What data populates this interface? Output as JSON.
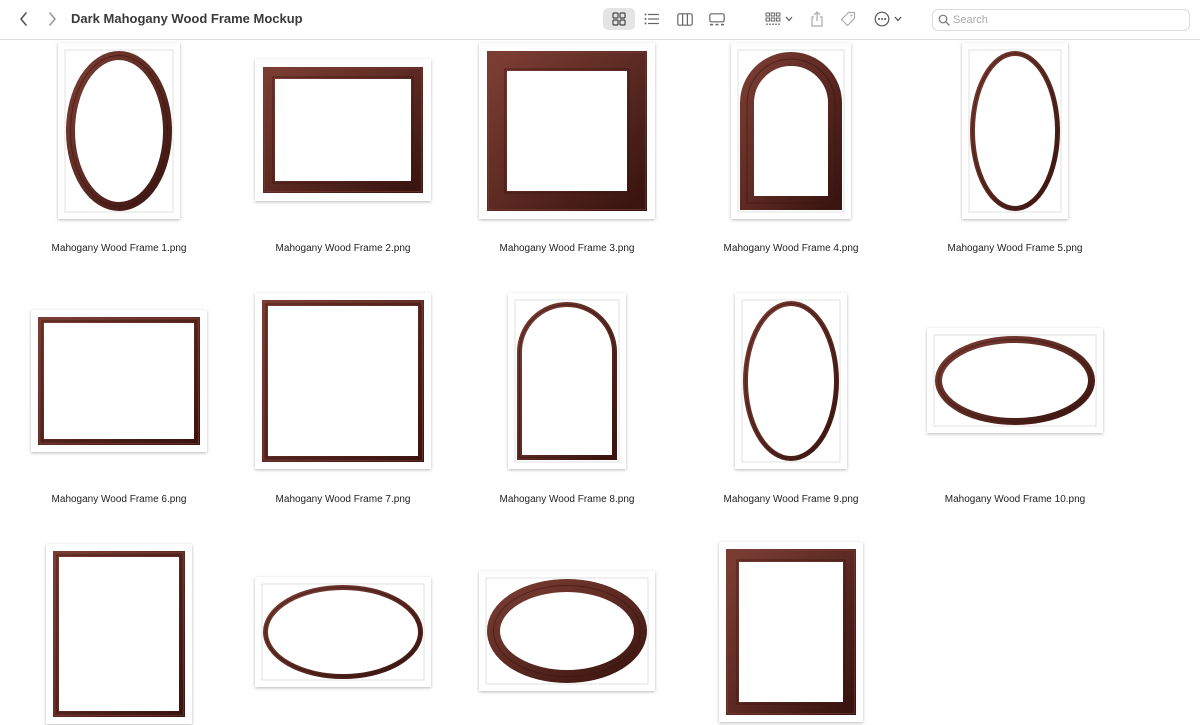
{
  "window": {
    "title": "Dark Mahogany Wood Frame Mockup"
  },
  "toolbar": {
    "icons": [
      "chevron-left-icon",
      "chevron-right-icon",
      "grid-view-icon",
      "list-view-icon",
      "column-view-icon",
      "gallery-view-icon",
      "group-icon",
      "share-icon",
      "tag-icon",
      "more-icon"
    ]
  },
  "search": {
    "placeholder": "Search"
  },
  "colors": {
    "frame_dark": "#3a1410",
    "frame_mid": "#5c2a22",
    "frame_light": "#7a3d33",
    "active_segment": "#e4e4e4"
  },
  "files": [
    {
      "name": "Mahogany Wood Frame 1.png",
      "shape": "oval-portrait"
    },
    {
      "name": "Mahogany Wood Frame 2.png",
      "shape": "rect-landscape"
    },
    {
      "name": "Mahogany Wood Frame 3.png",
      "shape": "rect-square-wide"
    },
    {
      "name": "Mahogany Wood Frame 4.png",
      "shape": "arch"
    },
    {
      "name": "Mahogany Wood Frame 5.png",
      "shape": "oval-portrait-thin"
    },
    {
      "name": "Mahogany Wood Frame 6.png",
      "shape": "rect-landscape-thin"
    },
    {
      "name": "Mahogany Wood Frame 7.png",
      "shape": "rect-square-thin"
    },
    {
      "name": "Mahogany Wood Frame 8.png",
      "shape": "arch-thin"
    },
    {
      "name": "Mahogany Wood Frame 9.png",
      "shape": "oval-portrait-thin"
    },
    {
      "name": "Mahogany Wood Frame 10.png",
      "shape": "oval-landscape"
    },
    {
      "name": "",
      "shape": "rect-portrait-thin"
    },
    {
      "name": "",
      "shape": "oval-landscape-thin"
    },
    {
      "name": "",
      "shape": "oval-landscape-wide"
    },
    {
      "name": "",
      "shape": "rect-portrait-wide"
    }
  ]
}
